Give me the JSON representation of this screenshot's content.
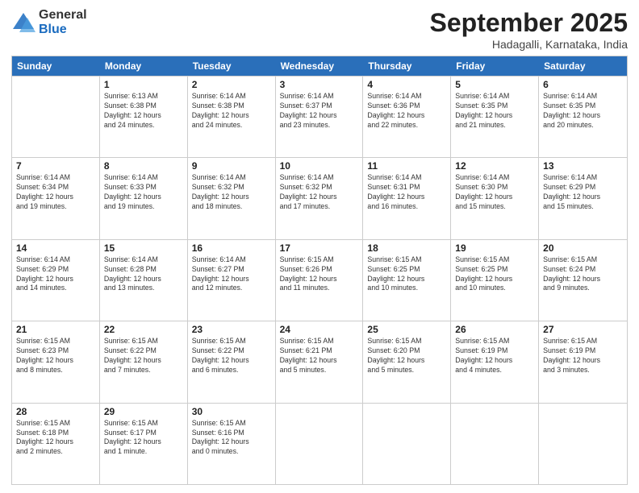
{
  "logo": {
    "general": "General",
    "blue": "Blue"
  },
  "title": "September 2025",
  "subtitle": "Hadagalli, Karnataka, India",
  "header_days": [
    "Sunday",
    "Monday",
    "Tuesday",
    "Wednesday",
    "Thursday",
    "Friday",
    "Saturday"
  ],
  "rows": [
    [
      {
        "day": "",
        "info": ""
      },
      {
        "day": "1",
        "info": "Sunrise: 6:13 AM\nSunset: 6:38 PM\nDaylight: 12 hours\nand 24 minutes."
      },
      {
        "day": "2",
        "info": "Sunrise: 6:14 AM\nSunset: 6:38 PM\nDaylight: 12 hours\nand 24 minutes."
      },
      {
        "day": "3",
        "info": "Sunrise: 6:14 AM\nSunset: 6:37 PM\nDaylight: 12 hours\nand 23 minutes."
      },
      {
        "day": "4",
        "info": "Sunrise: 6:14 AM\nSunset: 6:36 PM\nDaylight: 12 hours\nand 22 minutes."
      },
      {
        "day": "5",
        "info": "Sunrise: 6:14 AM\nSunset: 6:35 PM\nDaylight: 12 hours\nand 21 minutes."
      },
      {
        "day": "6",
        "info": "Sunrise: 6:14 AM\nSunset: 6:35 PM\nDaylight: 12 hours\nand 20 minutes."
      }
    ],
    [
      {
        "day": "7",
        "info": "Sunrise: 6:14 AM\nSunset: 6:34 PM\nDaylight: 12 hours\nand 19 minutes."
      },
      {
        "day": "8",
        "info": "Sunrise: 6:14 AM\nSunset: 6:33 PM\nDaylight: 12 hours\nand 19 minutes."
      },
      {
        "day": "9",
        "info": "Sunrise: 6:14 AM\nSunset: 6:32 PM\nDaylight: 12 hours\nand 18 minutes."
      },
      {
        "day": "10",
        "info": "Sunrise: 6:14 AM\nSunset: 6:32 PM\nDaylight: 12 hours\nand 17 minutes."
      },
      {
        "day": "11",
        "info": "Sunrise: 6:14 AM\nSunset: 6:31 PM\nDaylight: 12 hours\nand 16 minutes."
      },
      {
        "day": "12",
        "info": "Sunrise: 6:14 AM\nSunset: 6:30 PM\nDaylight: 12 hours\nand 15 minutes."
      },
      {
        "day": "13",
        "info": "Sunrise: 6:14 AM\nSunset: 6:29 PM\nDaylight: 12 hours\nand 15 minutes."
      }
    ],
    [
      {
        "day": "14",
        "info": "Sunrise: 6:14 AM\nSunset: 6:29 PM\nDaylight: 12 hours\nand 14 minutes."
      },
      {
        "day": "15",
        "info": "Sunrise: 6:14 AM\nSunset: 6:28 PM\nDaylight: 12 hours\nand 13 minutes."
      },
      {
        "day": "16",
        "info": "Sunrise: 6:14 AM\nSunset: 6:27 PM\nDaylight: 12 hours\nand 12 minutes."
      },
      {
        "day": "17",
        "info": "Sunrise: 6:15 AM\nSunset: 6:26 PM\nDaylight: 12 hours\nand 11 minutes."
      },
      {
        "day": "18",
        "info": "Sunrise: 6:15 AM\nSunset: 6:25 PM\nDaylight: 12 hours\nand 10 minutes."
      },
      {
        "day": "19",
        "info": "Sunrise: 6:15 AM\nSunset: 6:25 PM\nDaylight: 12 hours\nand 10 minutes."
      },
      {
        "day": "20",
        "info": "Sunrise: 6:15 AM\nSunset: 6:24 PM\nDaylight: 12 hours\nand 9 minutes."
      }
    ],
    [
      {
        "day": "21",
        "info": "Sunrise: 6:15 AM\nSunset: 6:23 PM\nDaylight: 12 hours\nand 8 minutes."
      },
      {
        "day": "22",
        "info": "Sunrise: 6:15 AM\nSunset: 6:22 PM\nDaylight: 12 hours\nand 7 minutes."
      },
      {
        "day": "23",
        "info": "Sunrise: 6:15 AM\nSunset: 6:22 PM\nDaylight: 12 hours\nand 6 minutes."
      },
      {
        "day": "24",
        "info": "Sunrise: 6:15 AM\nSunset: 6:21 PM\nDaylight: 12 hours\nand 5 minutes."
      },
      {
        "day": "25",
        "info": "Sunrise: 6:15 AM\nSunset: 6:20 PM\nDaylight: 12 hours\nand 5 minutes."
      },
      {
        "day": "26",
        "info": "Sunrise: 6:15 AM\nSunset: 6:19 PM\nDaylight: 12 hours\nand 4 minutes."
      },
      {
        "day": "27",
        "info": "Sunrise: 6:15 AM\nSunset: 6:19 PM\nDaylight: 12 hours\nand 3 minutes."
      }
    ],
    [
      {
        "day": "28",
        "info": "Sunrise: 6:15 AM\nSunset: 6:18 PM\nDaylight: 12 hours\nand 2 minutes."
      },
      {
        "day": "29",
        "info": "Sunrise: 6:15 AM\nSunset: 6:17 PM\nDaylight: 12 hours\nand 1 minute."
      },
      {
        "day": "30",
        "info": "Sunrise: 6:15 AM\nSunset: 6:16 PM\nDaylight: 12 hours\nand 0 minutes."
      },
      {
        "day": "",
        "info": ""
      },
      {
        "day": "",
        "info": ""
      },
      {
        "day": "",
        "info": ""
      },
      {
        "day": "",
        "info": ""
      }
    ]
  ]
}
